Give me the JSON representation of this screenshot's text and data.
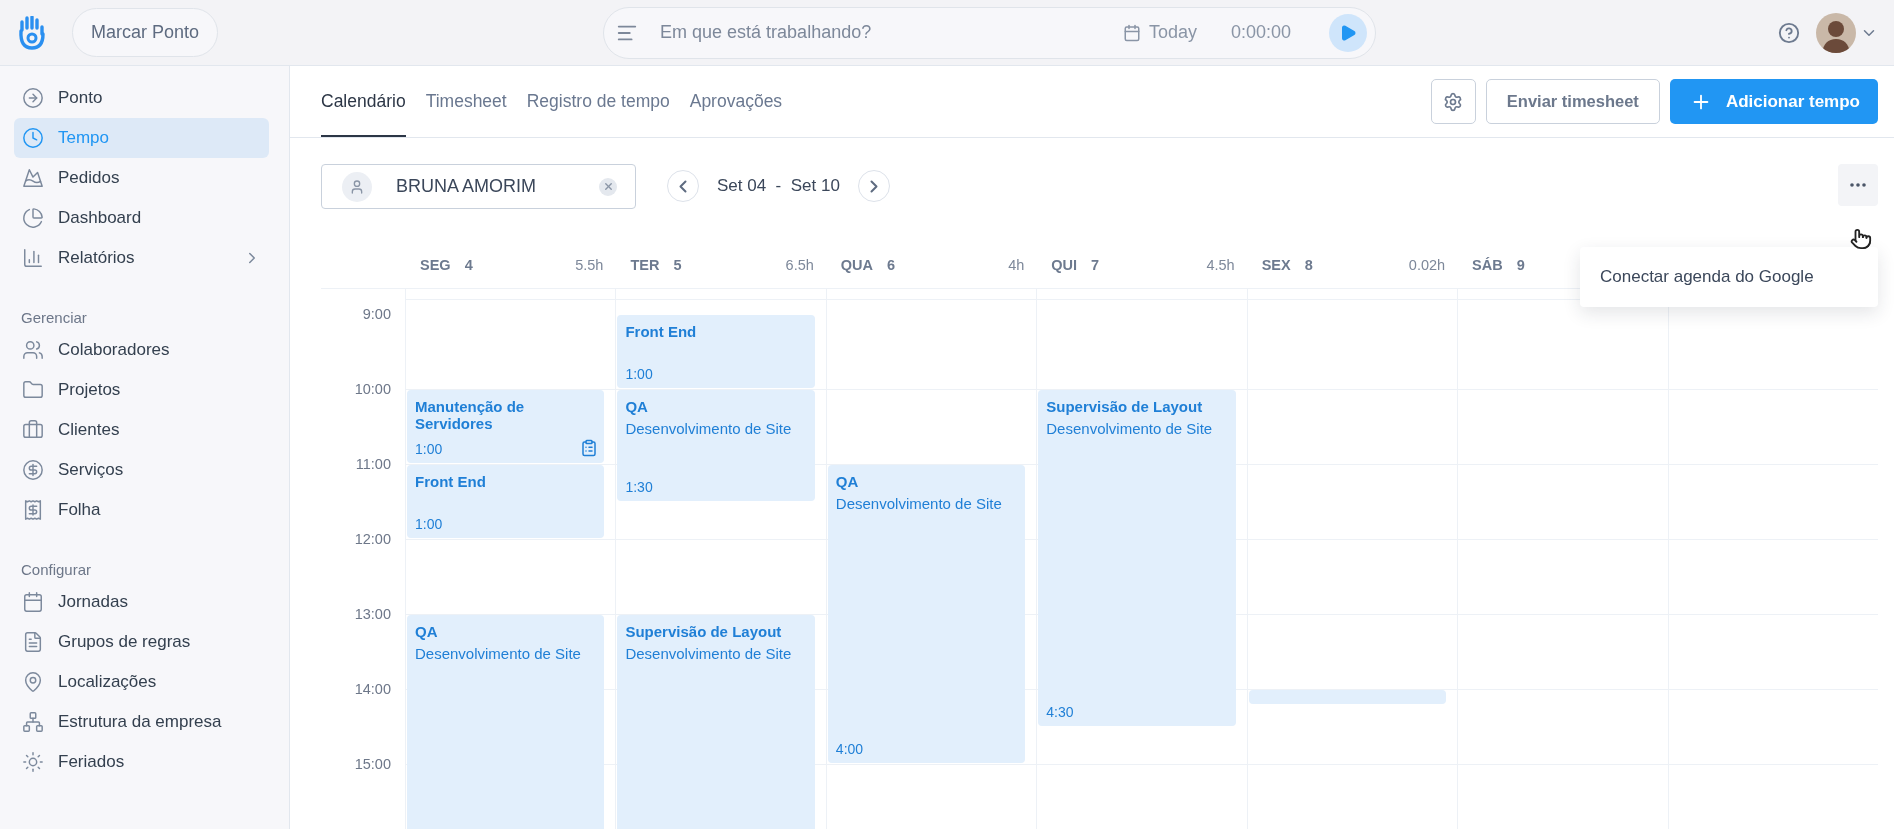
{
  "topbar": {
    "clock_button": "Marcar Ponto",
    "timer": {
      "placeholder": "Em que está trabalhando?",
      "date": "Today",
      "elapsed": "0:00:00"
    }
  },
  "sidebar": {
    "sections": [
      {
        "items": [
          {
            "label": "Ponto",
            "selected": false
          },
          {
            "label": "Tempo",
            "selected": true
          },
          {
            "label": "Pedidos",
            "selected": false
          },
          {
            "label": "Dashboard",
            "selected": false
          },
          {
            "label": "Relatórios",
            "selected": false,
            "has_submenu": true
          }
        ]
      },
      {
        "heading": "Gerenciar",
        "items": [
          {
            "label": "Colaboradores",
            "selected": false
          },
          {
            "label": "Projetos",
            "selected": false
          },
          {
            "label": "Clientes",
            "selected": false
          },
          {
            "label": "Serviços",
            "selected": false
          },
          {
            "label": "Folha",
            "selected": false
          }
        ]
      },
      {
        "heading": "Configurar",
        "items": [
          {
            "label": "Jornadas",
            "selected": false
          },
          {
            "label": "Grupos de regras",
            "selected": false
          },
          {
            "label": "Localizações",
            "selected": false
          },
          {
            "label": "Estrutura da empresa",
            "selected": false
          },
          {
            "label": "Feriados",
            "selected": false
          }
        ]
      }
    ]
  },
  "tabs": [
    {
      "label": "Calendário",
      "selected": true
    },
    {
      "label": "Timesheet",
      "selected": false
    },
    {
      "label": "Registro de tempo",
      "selected": false
    },
    {
      "label": "Aprovações",
      "selected": false
    }
  ],
  "actions": {
    "submit": "Enviar timesheet",
    "add": "Adicionar tempo"
  },
  "user_filter": {
    "value": "BRUNA AMORIM"
  },
  "date_range": "Set 04  -  Set 10",
  "menu": {
    "open": true,
    "items": [
      "Conectar agenda do Google"
    ]
  },
  "calendar": {
    "hours": [
      "9:00",
      "10:00",
      "11:00",
      "12:00",
      "13:00",
      "14:00",
      "15:00"
    ],
    "days": [
      {
        "day": "SEG",
        "date": "4",
        "total": "5.5h",
        "events": [
          {
            "kind": "block",
            "title": "Manutenção de Servidores",
            "duration": "1:00",
            "has_note": true
          },
          {
            "kind": "block",
            "title": "Front End",
            "duration": "1:00"
          },
          {
            "kind": "block",
            "title": "QA",
            "project": "Desenvolvimento de Site"
          }
        ]
      },
      {
        "day": "TER",
        "date": "5",
        "total": "6.5h",
        "events": [
          {
            "kind": "block",
            "title": "Front End",
            "duration": "1:00"
          },
          {
            "kind": "block",
            "title": "QA",
            "project": "Desenvolvimento de Site",
            "duration": "1:30"
          },
          {
            "kind": "block",
            "title": "Supervisão de Layout",
            "project": "Desenvolvimento de Site"
          }
        ]
      },
      {
        "day": "QUA",
        "date": "6",
        "total": "4h",
        "events": [
          {
            "kind": "block",
            "title": "QA",
            "project": "Desenvolvimento de Site",
            "duration": "4:00"
          }
        ]
      },
      {
        "day": "QUI",
        "date": "7",
        "total": "4.5h",
        "events": [
          {
            "kind": "block",
            "title": "Supervisão de Layout",
            "project": "Desenvolvimento de Site",
            "duration": "4:30"
          }
        ]
      },
      {
        "day": "SEX",
        "date": "8",
        "total": "0.02h",
        "events": [
          {
            "kind": "sliver"
          }
        ]
      },
      {
        "day": "SÁB",
        "date": "9"
      }
    ]
  }
}
